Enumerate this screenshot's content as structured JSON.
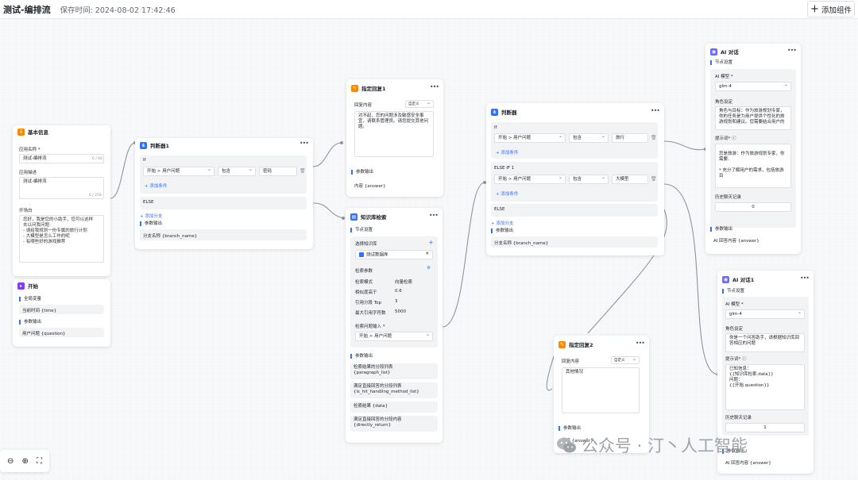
{
  "header": {
    "title": "测试-编排流",
    "save_time": "保存时间: 2024-08-02 17:42:46",
    "add_btn": "添加组件",
    "add_icon": "+"
  },
  "basic": {
    "title": "基本信息",
    "name_label": "应用名称 *",
    "name_value": "测试-编排流",
    "name_count": "6 / 64",
    "desc_label": "应用描述",
    "desc_value": "测试-编排流",
    "desc_count": "6 / 256",
    "opening_label": "开场白",
    "opening_value": "您好，我是您的小助手，您可以这样\n去以问我问题:\n- 请给我规划一份专属的旅行计划\n- 大模型是怎么工作的呢\n- 有哪些好的游戏推荐"
  },
  "start": {
    "title": "开始",
    "global_label": "全局变量",
    "global_value": "当前时间 {time}",
    "params_label": "参数输出",
    "params_value": "用户问题 {question}"
  },
  "judge1": {
    "title": "判断器1",
    "if_label": "If",
    "field": "开始 > 用户问题",
    "op": "包含",
    "val": "密码",
    "add_cond": "+ 添加条件",
    "else": "ELSE",
    "add_branch": "+ 添加分支",
    "out_label": "参数输出",
    "out_value": "分支名称 {branch_name}"
  },
  "reply1": {
    "title": "指定回复1",
    "content_label": "回复内容",
    "mode": "自定义",
    "text": "对不起，您的问题涉及敏感安全事宜，请联系管理员。请您提交其他问题。",
    "out_label": "参数输出",
    "out_value": "内容 {answer}"
  },
  "kb": {
    "title": "知识库检索",
    "node_label": "节点设置",
    "select_label": "选择知识库",
    "kb_name": "测试数据库",
    "search_label": "检索参数",
    "params": [
      [
        "检索模式",
        "向量检索"
      ],
      [
        "相似度高于",
        "0.6"
      ],
      [
        "引用分段 Top",
        "3"
      ],
      [
        "最大引用字符数",
        "5000"
      ]
    ],
    "q_label": "检索问题输入 *",
    "q_value": "开始 > 用户问题",
    "out_label": "参数输出",
    "outputs": [
      "检索结果的分段列表\n{paragraph_list}",
      "满足直接回答的分段列表\n{is_hit_handling_method_list}",
      "检索结果 {data}",
      "满足直接回答的分段内容\n{directly_return}"
    ]
  },
  "judge2": {
    "title": "判断器",
    "if_label": "If",
    "if_field": "开始 > 用户问题",
    "if_op": "包含",
    "if_val": "旅行",
    "add_cond": "+ 添加条件",
    "elseif_label": "ELSE IF 1",
    "elseif_field": "开始 > 用户问题",
    "elseif_op": "包含",
    "elseif_val": "大模型",
    "add_cond2": "+ 添加条件",
    "else": "ELSE",
    "add_branch": "+ 添加分支",
    "out_label": "参数输出",
    "out_value": "分支名称 {branch_name}"
  },
  "ai1": {
    "title": "AI 对话",
    "node_label": "节点设置",
    "model_label": "AI 模型 *",
    "model": "glm-4",
    "role_label": "角色设定",
    "role": "角色与目标：作为旅游规划专家，你的任务是为用户提供个性化的旅游规划和建议。您需要结合用户的",
    "prompt_label": "提示词* ⓘ",
    "prompt": "\n您是旅游：作为旅游规划专家，你需要:\n\n* 充分了解用户的需求，包括旅游目",
    "hist_label": "历史聊天记录",
    "hist_val": "0",
    "out_label": "参数输出",
    "out_value": "AI 回答内容 {answer}"
  },
  "ai2": {
    "title": "AI 对话1",
    "node_label": "节点设置",
    "model_label": "AI 模型 *",
    "model": "glm-4",
    "role_label": "角色设定",
    "role": "你是一个问答助手，请根据知识库回答相应的问题",
    "prompt_label": "提示词* ⓘ",
    "prompt": "已知信息：\n{{知识库检索.data}}\n问题：\n{{开始.question}}",
    "hist_label": "历史聊天记录",
    "hist_val": "1",
    "out_label": "参数输出",
    "out_value": "AI 回答内容 {answer}"
  },
  "reply2": {
    "title": "指定回复2",
    "content_label": "回复内容",
    "mode": "自定义",
    "text": "其他情况",
    "out_label": "参数输出",
    "out_value": "内容 {answer}"
  },
  "watermark": "公众号 · 汀丶人工智能",
  "zoom": {
    "out": "⊖",
    "in": "⊕",
    "fit": "⛶"
  },
  "colors": {
    "accent": "#3370ff",
    "orange": "#ff8800",
    "start_purple": "#7f3bf5",
    "basic_orange": "#ff8800",
    "ai": "#3370ff"
  }
}
